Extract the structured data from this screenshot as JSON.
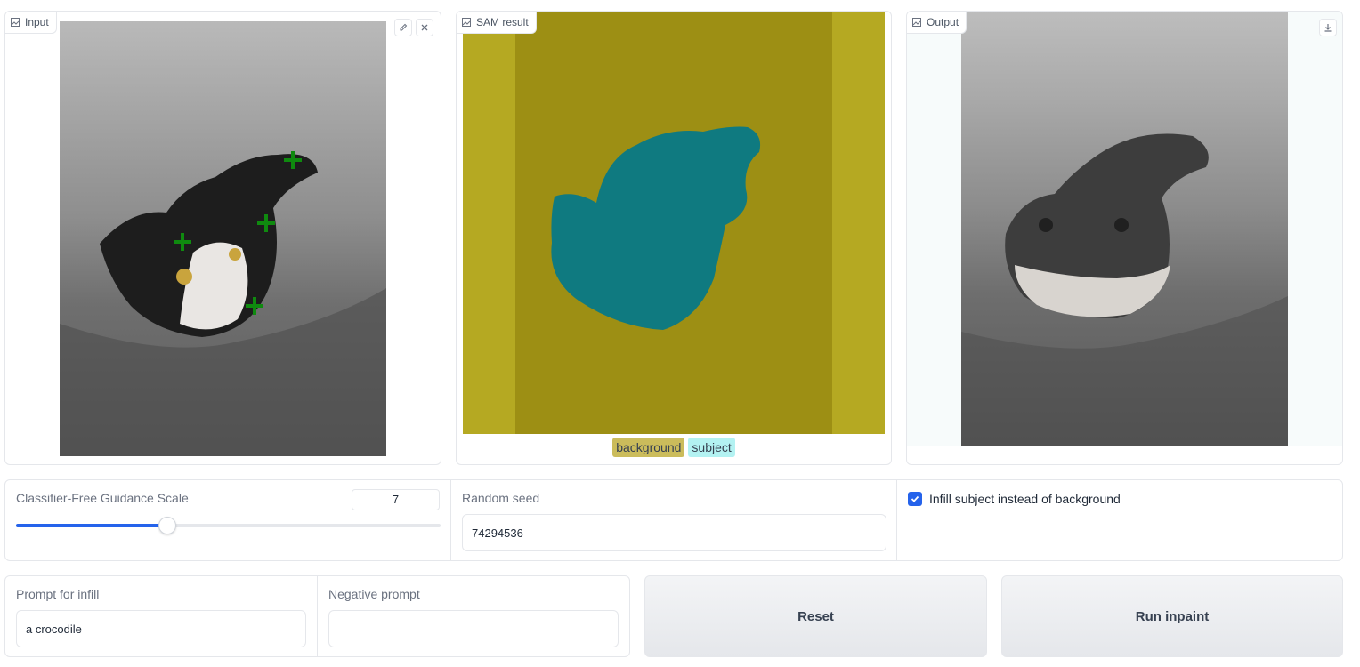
{
  "input_panel": {
    "label": "Input",
    "image_icon": "image-icon",
    "edit_icon": "pencil-icon",
    "clear_icon": "close-icon"
  },
  "sam_panel": {
    "label": "SAM result",
    "image_icon": "image-icon",
    "legend": [
      {
        "label": "background",
        "color": "#cbbc5b"
      },
      {
        "label": "subject",
        "color": "#b3f2f2"
      }
    ]
  },
  "output_panel": {
    "label": "Output",
    "image_icon": "image-icon",
    "download_icon": "download-icon"
  },
  "guidance": {
    "label": "Classifier-Free Guidance Scale",
    "value": "7",
    "slider_fraction": 0.355
  },
  "seed": {
    "label": "Random seed",
    "value": "74294536"
  },
  "infill_option": {
    "label": "Infill subject instead of background",
    "checked": true
  },
  "prompt": {
    "label": "Prompt for infill",
    "value": "a crocodile"
  },
  "negative_prompt": {
    "label": "Negative prompt",
    "value": ""
  },
  "buttons": {
    "reset": "Reset",
    "run": "Run inpaint"
  },
  "colors": {
    "accent": "#2563eb",
    "mark_green": "#0f8a0f",
    "sam_background": "#b5a922",
    "sam_subject": "#0f7a80"
  }
}
